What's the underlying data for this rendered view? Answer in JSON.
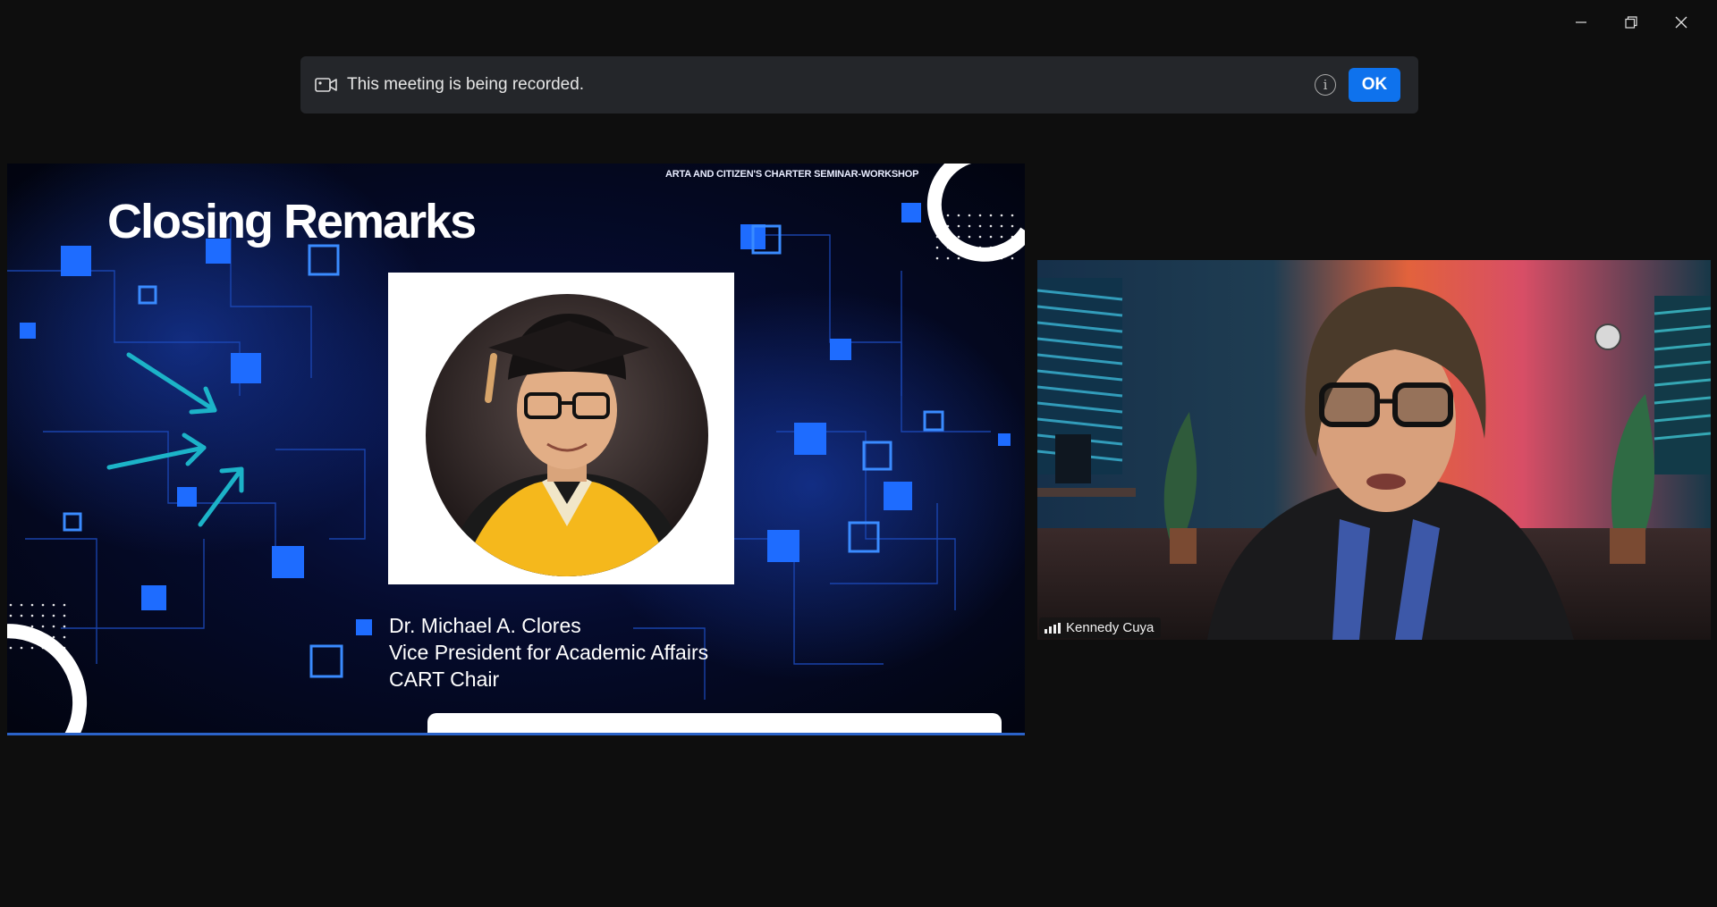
{
  "window": {
    "controls": [
      "minimize",
      "restore",
      "close"
    ]
  },
  "banner": {
    "text": "This meeting is being recorded.",
    "info_glyph": "i",
    "ok_label": "OK",
    "ok_color": "#0e72ed"
  },
  "slide": {
    "header": "ARTA AND CITIZEN'S CHARTER SEMINAR-WORKSHOP",
    "title": "Closing Remarks",
    "speaker_name": "Dr. Michael A. Clores",
    "speaker_role": "Vice President for Academic Affairs",
    "speaker_role2": "CART Chair"
  },
  "participant": {
    "name": "Kennedy Cuya"
  }
}
